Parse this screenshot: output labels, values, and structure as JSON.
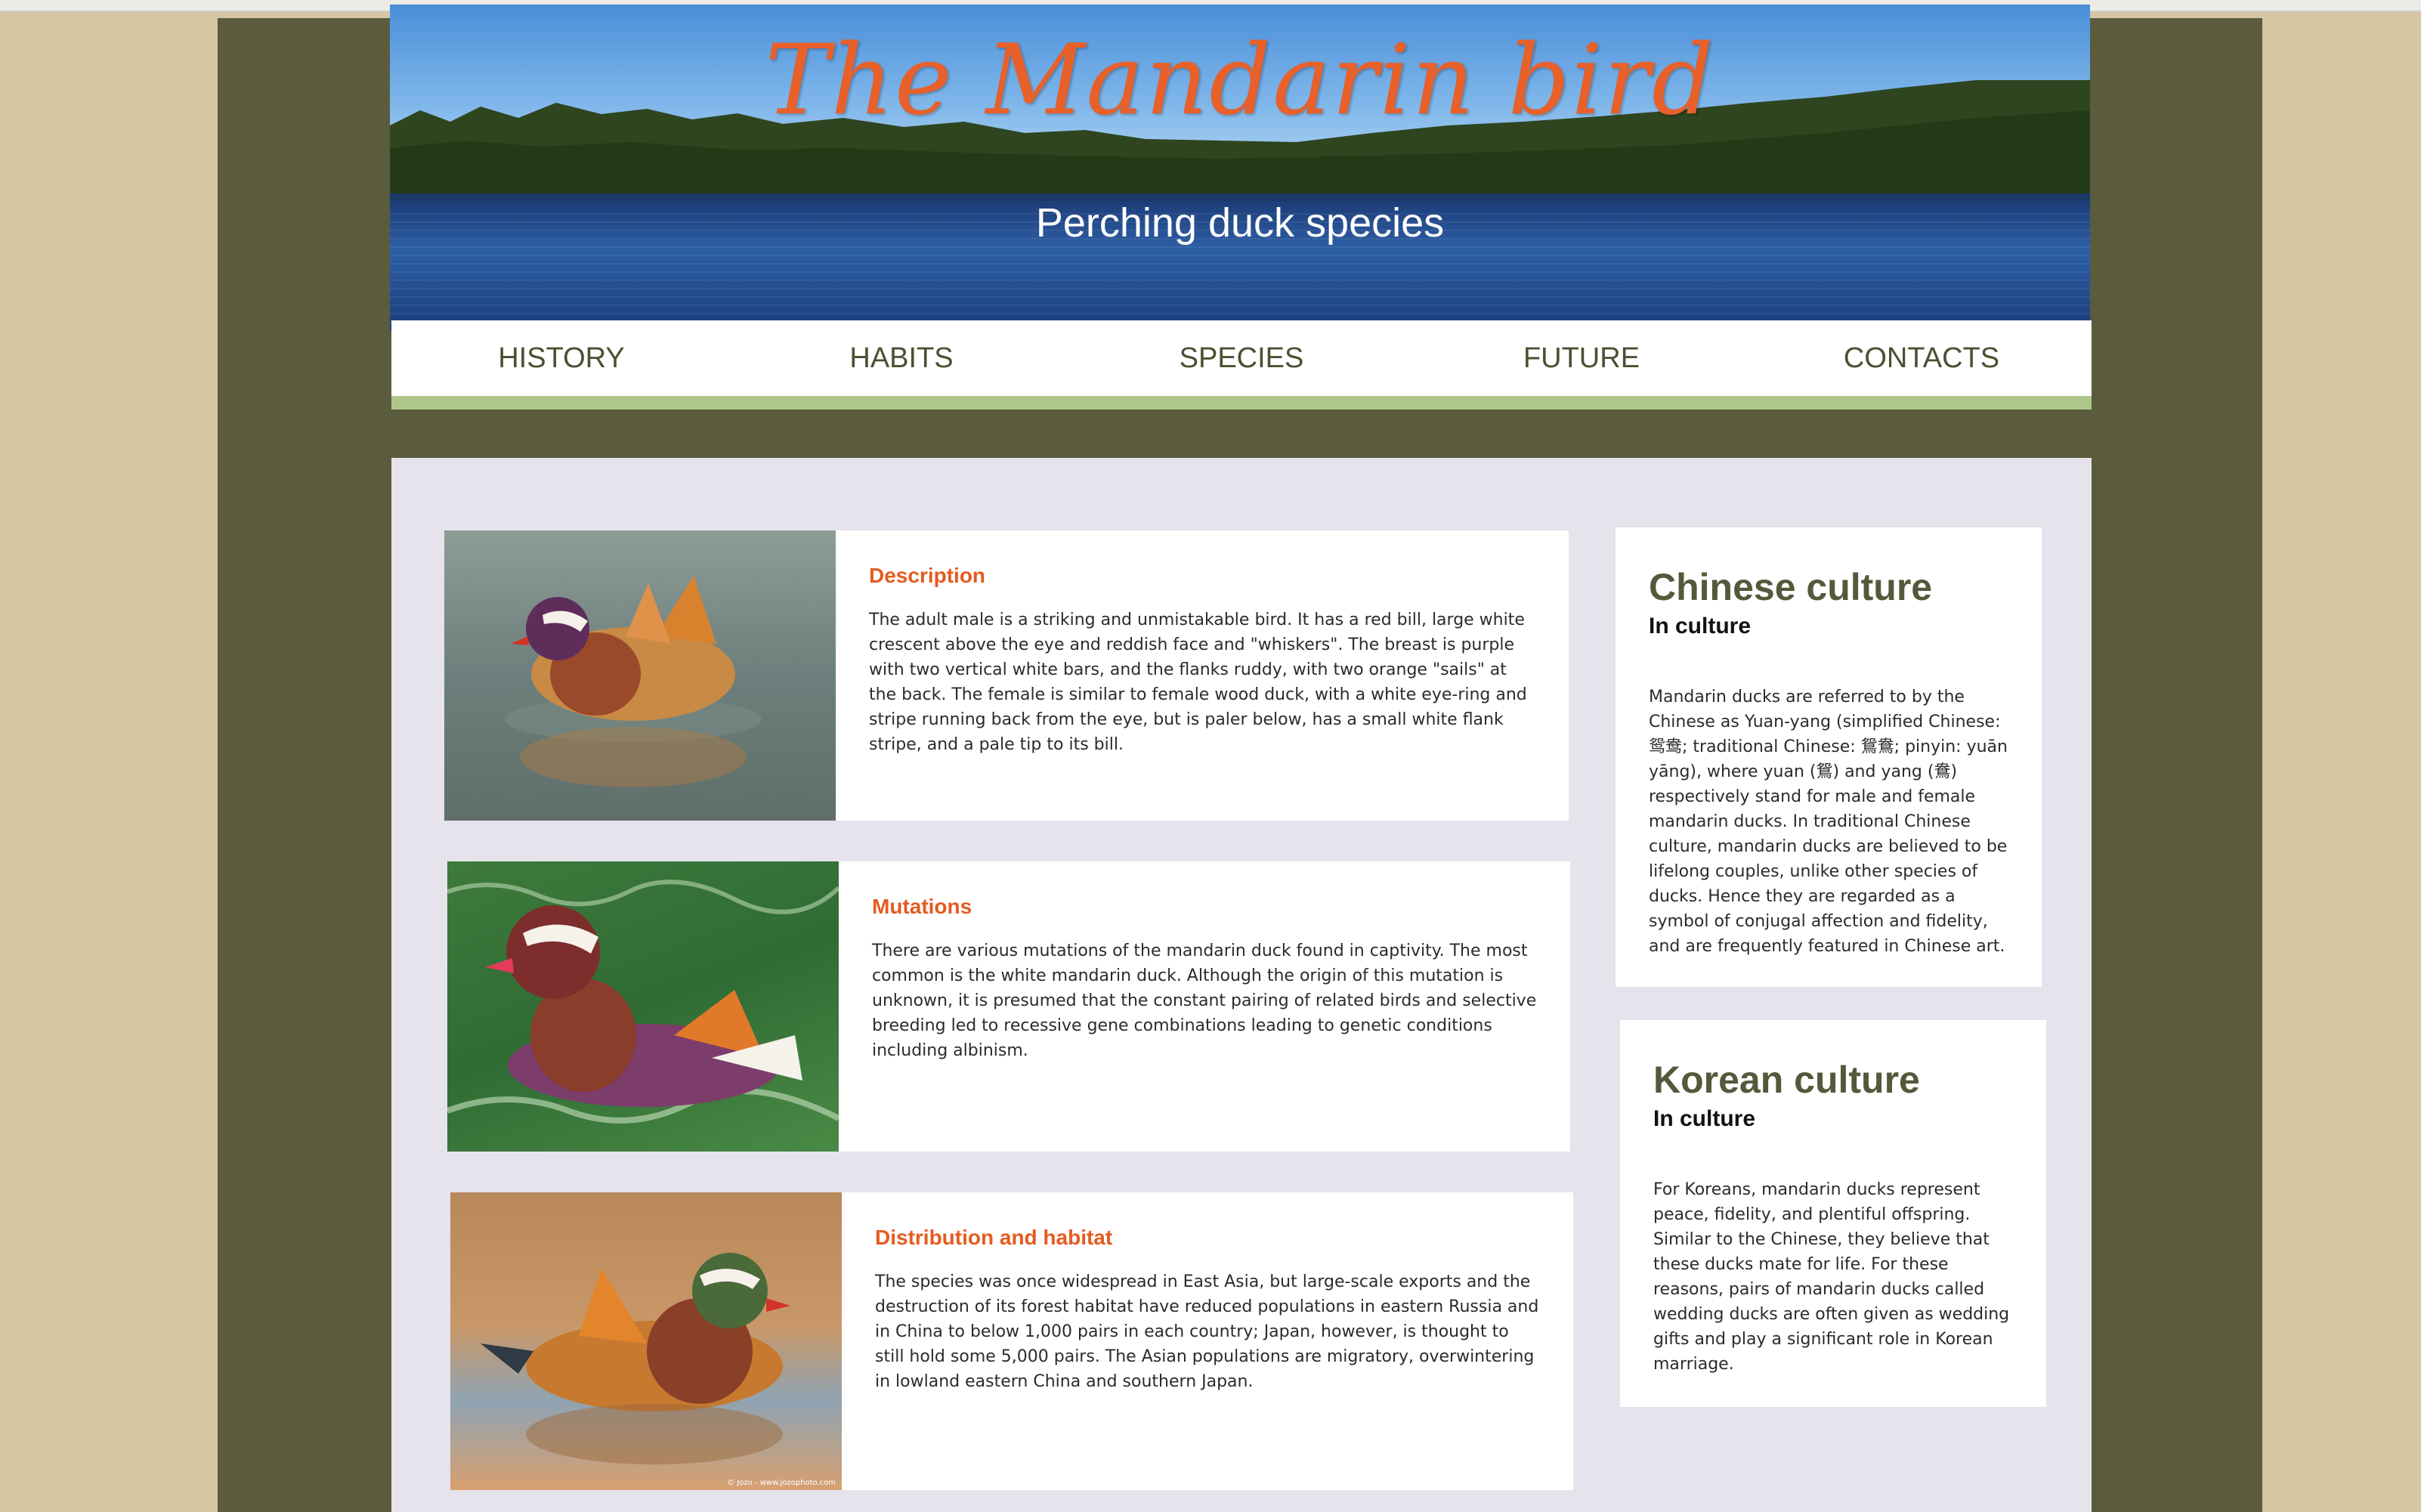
{
  "header": {
    "title": "The Mandarin bird",
    "subtitle": "Perching duck species"
  },
  "nav": {
    "items": [
      {
        "label": "HISTORY"
      },
      {
        "label": "HABITS"
      },
      {
        "label": "SPECIES"
      },
      {
        "label": "FUTURE"
      },
      {
        "label": "CONTACTS"
      }
    ]
  },
  "articles": [
    {
      "heading": "Description",
      "text": "The adult male is a striking and unmistakable bird. It has a red bill, large white crescent above the eye and reddish face and \"whiskers\". The breast is purple with two vertical white bars, and the flanks ruddy, with two orange \"sails\" at the back. The female is similar to female wood duck, with a white eye-ring and stripe running back from the eye, but is paler below, has a small white flank stripe, and a pale tip to its bill."
    },
    {
      "heading": "Mutations",
      "text": "There are various mutations of the mandarin duck found in captivity. The most common is the white mandarin duck. Although the origin of this mutation is unknown, it is presumed that the constant pairing of related birds and selective breeding led to recessive gene combinations leading to genetic conditions including albinism."
    },
    {
      "heading": "Distribution and habitat",
      "text": "The species was once widespread in East Asia, but large-scale exports and the destruction of its forest habitat have reduced populations in eastern Russia and in China to below 1,000 pairs in each country; Japan, however, is thought to still hold some 5,000 pairs. The Asian populations are migratory, overwintering in lowland eastern China and southern Japan.",
      "photo_credit": "© Jozo - www.jozophoto.com"
    }
  ],
  "sidebar": [
    {
      "title": "Chinese culture",
      "subtitle": "In culture",
      "text": "Mandarin ducks are referred to by the Chinese as Yuan-yang (simplified Chinese: 鸳鸯; traditional Chinese: 鴛鴦; pinyin: yuān yāng), where yuan (鴛) and yang (鴦) respectively stand for male and female mandarin ducks. In traditional Chinese culture, mandarin ducks are believed to be lifelong couples, unlike other species of ducks. Hence they are regarded as a symbol of conjugal affection and fidelity, and are frequently featured in Chinese art."
    },
    {
      "title": "Korean culture",
      "subtitle": "In culture",
      "text": "For Koreans, mandarin ducks represent peace, fidelity, and plentiful offspring. Similar to the Chinese, they believe that these ducks mate for life. For these reasons, pairs of mandarin ducks called wedding ducks are often given as wedding gifts and play a significant role in Korean marriage."
    }
  ],
  "colors": {
    "frame": "#5a5c3d",
    "outer_background": "#d6c6a4",
    "panel": "#e6e3ec",
    "accent_orange": "#e55b21",
    "nav_accent": "#afc68a"
  }
}
